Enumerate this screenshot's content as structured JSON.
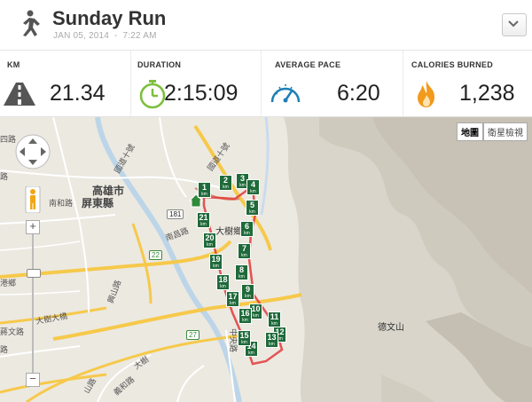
{
  "header": {
    "title": "Sunday Run",
    "date": "JAN 05, 2014",
    "separator": "-",
    "time": "7:22 AM"
  },
  "stats": [
    {
      "label": "KM",
      "value": "21.34",
      "icon": "road-icon"
    },
    {
      "label": "DURATION",
      "value": "2:15:09",
      "icon": "stopwatch-icon"
    },
    {
      "label": "AVERAGE PACE",
      "value": "6:20",
      "icon": "speedometer-icon"
    },
    {
      "label": "CALORIES BURNED",
      "value": "1,238",
      "icon": "flame-icon"
    }
  ],
  "map": {
    "maptype_map": "地圖",
    "maptype_satellite": "衛星檢視",
    "zoom_in": "+",
    "zoom_out": "−",
    "km_unit": "km",
    "markers": [
      "1",
      "2",
      "3",
      "4",
      "5",
      "6",
      "7",
      "8",
      "9",
      "10",
      "11",
      "12",
      "13",
      "14",
      "15",
      "16",
      "17",
      "18",
      "19",
      "20",
      "21"
    ],
    "places": {
      "kaohsiung": "高雄市",
      "pingtung": "屏東縣",
      "road_upper": "國道十號",
      "road_left1": "四路",
      "road_left2": "路",
      "dashu": "大樹鄉",
      "nanchang": "南昌路",
      "shield_181": "181",
      "shield_22": "22",
      "shield_27": "27",
      "road_mid1": "國道十號",
      "xingshan": "興山路",
      "zhongyang": "中央路",
      "dechang": "德文山",
      "daqiao": "大樹大橋",
      "gang": "港鄉",
      "lujia": "路",
      "tianshan": "蔣文路",
      "nanhe": "南和路",
      "shanli": "山路",
      "dashu2": "大樹",
      "gaoshan": "高屏路",
      "yili": "義和路",
      "danguo": "國道路"
    }
  },
  "colors": {
    "accent_green": "#1f6a3a",
    "route": "#e03a3a",
    "flame": "#f29a1c",
    "stopwatch": "#7bbf3b",
    "pace": "#1e7fb5"
  }
}
